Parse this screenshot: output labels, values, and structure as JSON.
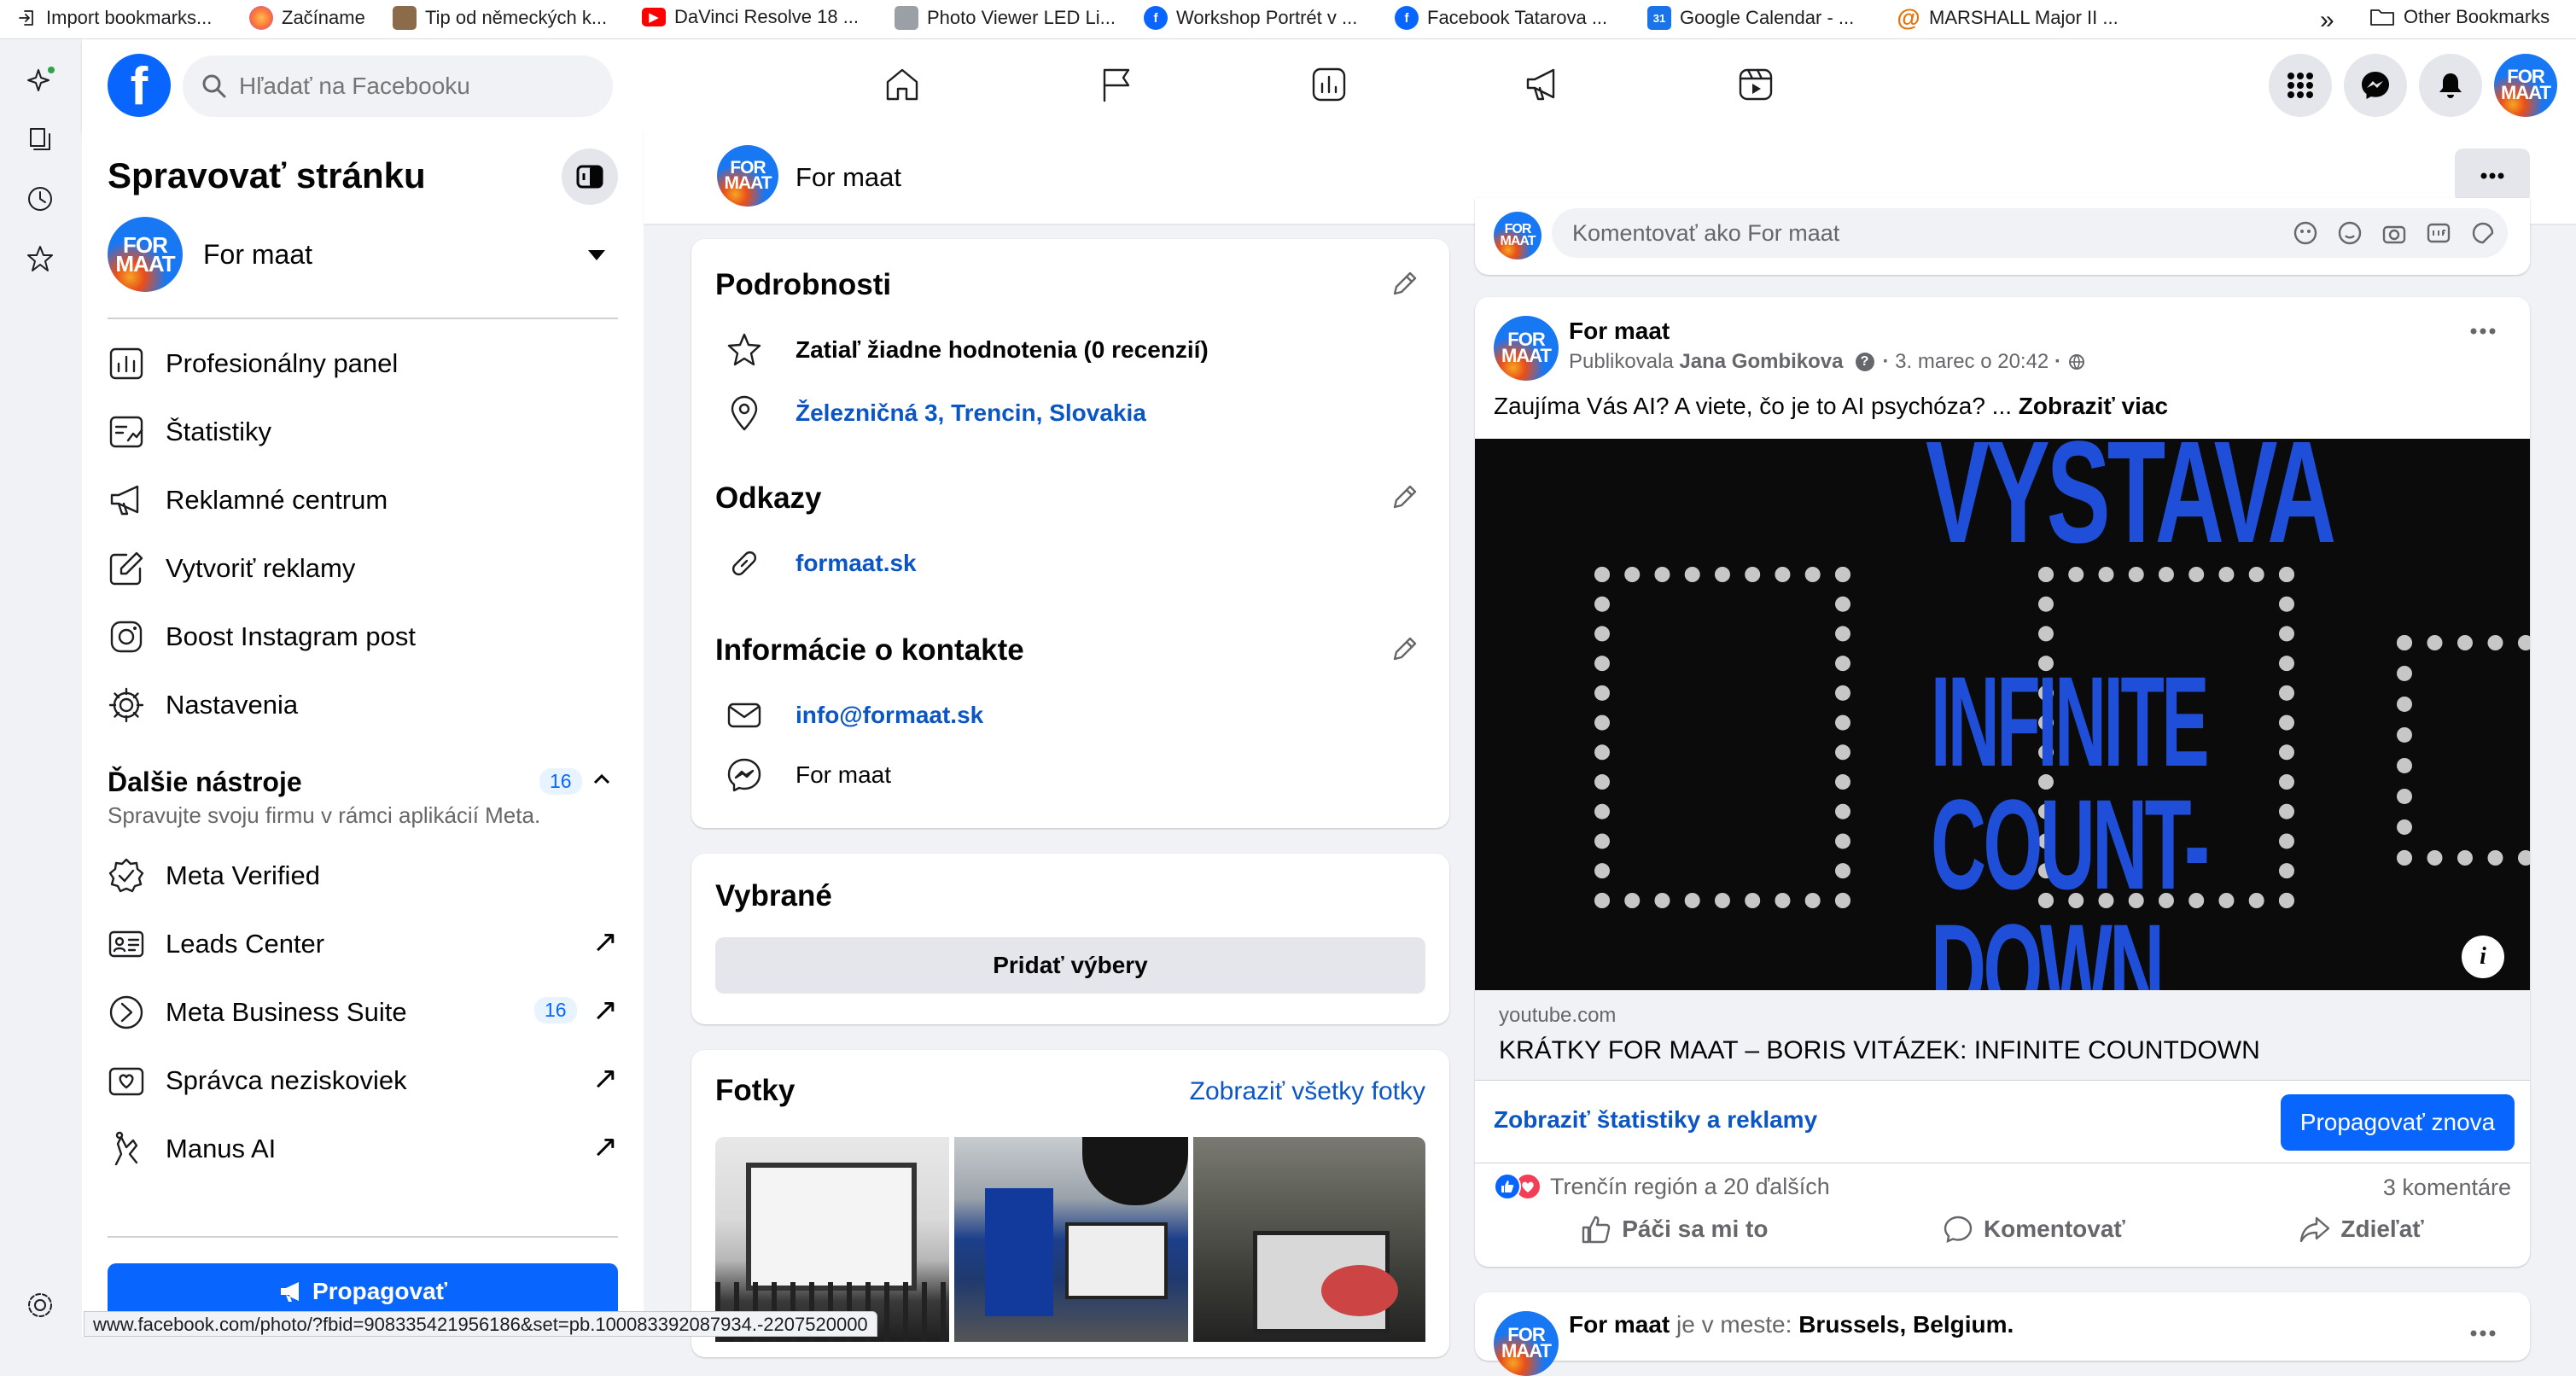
{
  "bookmarks": [
    {
      "label": "Import bookmarks...",
      "icon": "import-icon",
      "color": "#ffffff"
    },
    {
      "label": "Začíname",
      "icon": "firefox-icon",
      "color": "#ff7139"
    },
    {
      "label": "Tip od německých k...",
      "icon": "tip-icon",
      "color": "#8b6b4a"
    },
    {
      "label": "DaVinci Resolve 18 ...",
      "icon": "youtube-icon",
      "color": "#ff0000"
    },
    {
      "label": "Photo Viewer LED Li...",
      "icon": "photo-viewer-icon",
      "color": "#9aa0a6"
    },
    {
      "label": "Workshop Portrét v ...",
      "icon": "facebook-icon",
      "color": "#0866ff"
    },
    {
      "label": "Facebook Tatarova ...",
      "icon": "facebook-icon",
      "color": "#0866ff"
    },
    {
      "label": "Google Calendar - ...",
      "icon": "calendar-icon",
      "color": "#1a73e8"
    },
    {
      "label": "MARSHALL Major II ...",
      "icon": "at-icon",
      "color": "#e8710a"
    }
  ],
  "other_bookmarks": "Other Bookmarks",
  "search": {
    "placeholder": "Hľadať na Facebooku"
  },
  "sidebar": {
    "title": "Spravovať stránku",
    "page_name": "For maat",
    "items": [
      {
        "label": "Profesionálny panel",
        "icon": "dashboard-icon"
      },
      {
        "label": "Štatistiky",
        "icon": "insights-icon"
      },
      {
        "label": "Reklamné centrum",
        "icon": "megaphone-icon"
      },
      {
        "label": "Vytvoriť reklamy",
        "icon": "edit-icon"
      },
      {
        "label": "Boost Instagram post",
        "icon": "instagram-icon"
      },
      {
        "label": "Nastavenia",
        "icon": "gear-icon"
      }
    ],
    "more_tools": {
      "title": "Ďalšie nástroje",
      "count": "16",
      "subtitle": "Spravujte svoju firmu v rámci aplikácií Meta."
    },
    "tools": [
      {
        "label": "Meta Verified",
        "icon": "verified-icon"
      },
      {
        "label": "Leads Center",
        "icon": "leads-icon"
      },
      {
        "label": "Meta Business Suite",
        "icon": "business-suite-icon",
        "count": "16"
      },
      {
        "label": "Správca neziskoviek",
        "icon": "nonprofit-icon"
      },
      {
        "label": "Manus AI",
        "icon": "manus-icon"
      }
    ],
    "promote": "Propagovať"
  },
  "page_header": {
    "name": "For maat"
  },
  "logo_text": "FOR MAAT",
  "details": {
    "title": "Podrobnosti",
    "rating": "Zatiaľ žiadne hodnotenia (0 recenzií)",
    "address": "Železničná 3, Trencin, Slovakia",
    "links_title": "Odkazy",
    "website": "formaat.sk",
    "contact_title": "Informácie o kontakte",
    "email": "info@formaat.sk",
    "messenger": "For maat"
  },
  "featured": {
    "title": "Vybrané",
    "button": "Pridať výbery"
  },
  "photos": {
    "title": "Fotky",
    "see_all": "Zobraziť všetky fotky"
  },
  "composer": {
    "placeholder": "Komentovať ako For maat"
  },
  "post": {
    "author": "For maat",
    "published_by_label": "Publikovala",
    "published_by": "Jana Gombikova",
    "date": "3. marec o 20:42",
    "text": "Zaujíma Vás AI? A viete, čo je to AI psychóza? ...",
    "see_more": "Zobraziť viac",
    "image_text": [
      "VYSTAVA",
      "INFINITE",
      "COUNT-",
      "DOWN"
    ],
    "link_domain": "youtube.com",
    "link_title": "KRÁTKY FOR MAAT – BORIS VITÁZEK: INFINITE COUNTDOWN",
    "stats_link": "Zobraziť štatistiky a reklamy",
    "boost_again": "Propagovať znova",
    "reactions": "Trenčín región a 20 ďalších",
    "comments": "3 komentáre",
    "like": "Páči sa mi to",
    "comment": "Komentovať",
    "share": "Zdieľať"
  },
  "next_post": {
    "author": "For maat",
    "middle": "je v meste:",
    "place": "Brussels, Belgium."
  },
  "status_url": "www.facebook.com/photo/?fbid=908335421956186&set=pb.100083392087934.-2207520000"
}
